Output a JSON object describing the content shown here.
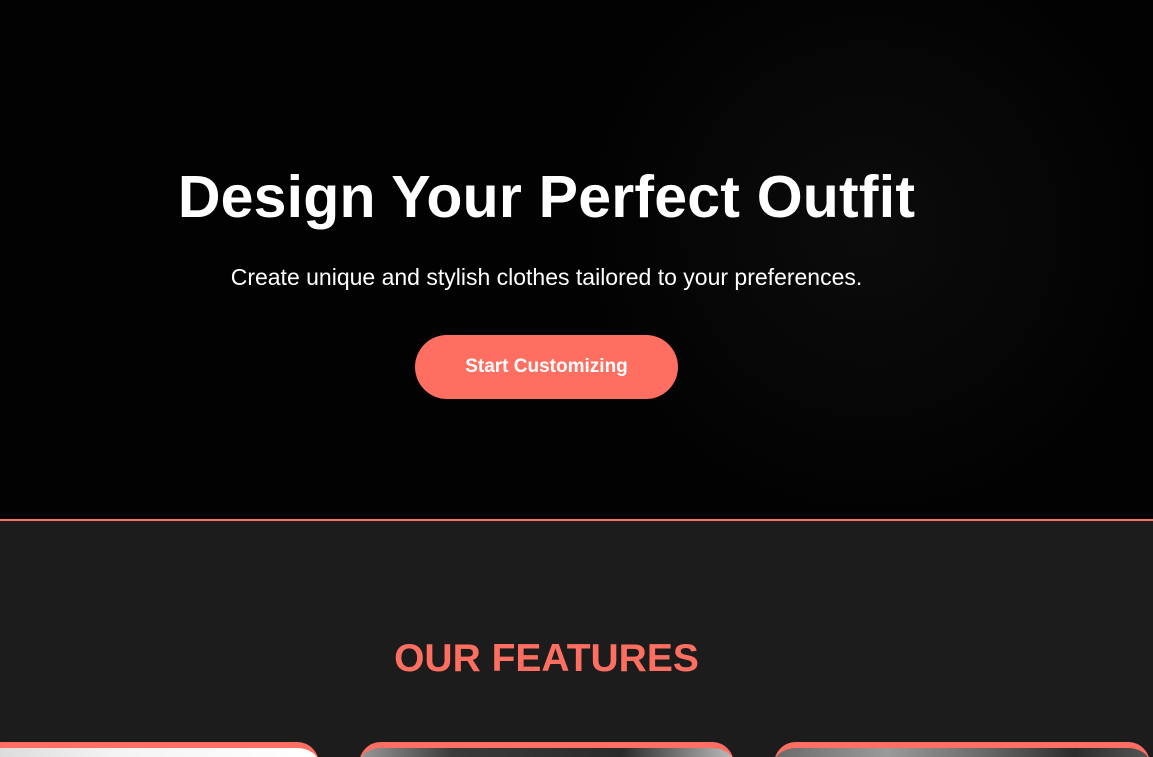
{
  "hero": {
    "title": "Design Your Perfect Outfit",
    "subtitle": "Create unique and stylish clothes tailored to your preferences.",
    "cta_label": "Start Customizing"
  },
  "features": {
    "title": "OUR FEATURES",
    "cards": [
      {
        "image": "feature-photo-1"
      },
      {
        "image": "feature-photo-2"
      },
      {
        "image": "feature-photo-3"
      }
    ]
  },
  "colors": {
    "accent": "#ff6f61",
    "hero_background": "#020202",
    "section_background": "#1c1c1c",
    "text": "#ffffff"
  }
}
